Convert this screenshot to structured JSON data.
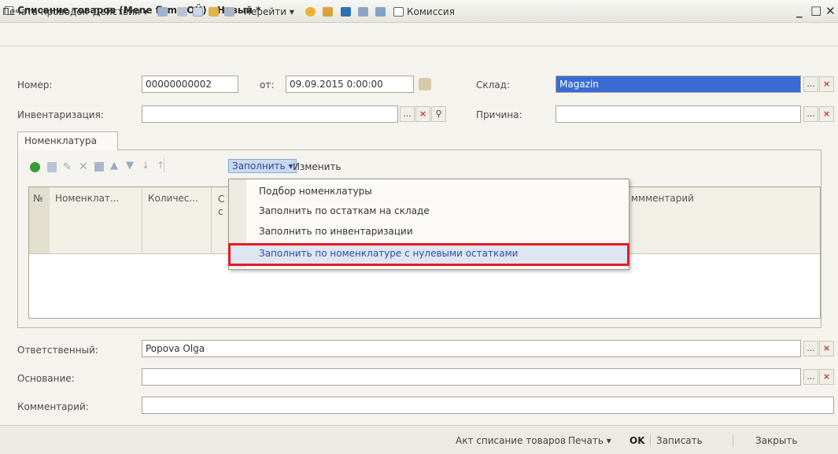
{
  "window": {
    "title": "Списание товаров (Mene firma OÜ) : Новый *",
    "minimize": "_",
    "maximize": "□",
    "close": "✕"
  },
  "toolbar": {
    "print_entries": "Печать проводок",
    "actions": "Действия",
    "goto": "Перейти",
    "commission": "Комиссия"
  },
  "header": {
    "number_label": "Номер:",
    "number_value": "00000000002",
    "from_label": "от:",
    "date_value": "09.09.2015 0:00:00",
    "warehouse_label": "Склад:",
    "warehouse_value": "Magazin",
    "inventory_label": "Инвентаризация:",
    "inventory_value": "",
    "reason_label": "Причина:",
    "reason_value": ""
  },
  "tabs": [
    {
      "label": "Номенклатура"
    }
  ],
  "table_toolbar": {
    "fill_label": "Заполнить",
    "change_label": "Изменить"
  },
  "table": {
    "columns": [
      "№",
      "Номенклат...",
      "Количес...",
      "С с",
      "ммментарий"
    ]
  },
  "fill_menu": {
    "items": [
      "Подбор номенклатуры",
      "Заполнить по остаткам на складе",
      "Заполнить по инвентаризации",
      "Заполнить по номенклатуре с нулевыми остатками"
    ],
    "highlighted_index": 3
  },
  "footer_fields": {
    "responsible_label": "Ответственный:",
    "responsible_value": "Popova Olga",
    "basis_label": "Основание:",
    "basis_value": "",
    "comment_label": "Комментарий:",
    "comment_value": ""
  },
  "statusbar": {
    "act": "Акт списание товаров",
    "print": "Печать",
    "ok": "OK",
    "save": "Записать",
    "close": "Закрыть"
  },
  "colors": {
    "highlight_border": "#e31c23",
    "warehouse_selected": "#3a6ad4"
  }
}
